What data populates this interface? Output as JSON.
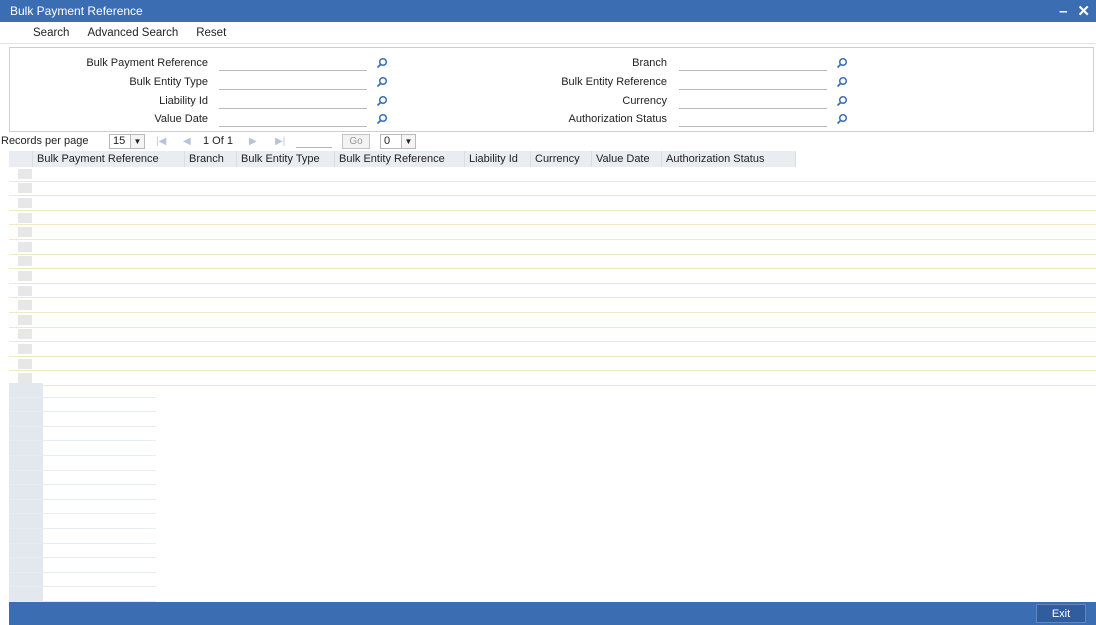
{
  "window": {
    "title": "Bulk Payment Reference",
    "minimize": "–",
    "close": "✕"
  },
  "toolbar": {
    "search": "Search",
    "advanced_search": "Advanced Search",
    "reset": "Reset"
  },
  "criteria": {
    "left": [
      {
        "label": "Bulk Payment Reference",
        "value": ""
      },
      {
        "label": "Bulk Entity Type",
        "value": ""
      },
      {
        "label": "Liability Id",
        "value": ""
      },
      {
        "label": "Value Date",
        "value": ""
      }
    ],
    "right": [
      {
        "label": "Branch",
        "value": ""
      },
      {
        "label": "Bulk Entity Reference",
        "value": ""
      },
      {
        "label": "Currency",
        "value": ""
      },
      {
        "label": "Authorization Status",
        "value": ""
      }
    ]
  },
  "pager": {
    "records_label": "Records per page",
    "records_value": "15",
    "page_info": "1 Of 1",
    "go_label": "Go",
    "go_select_value": "0"
  },
  "grid": {
    "columns": [
      "Bulk Payment Reference",
      "Branch",
      "Bulk Entity Type",
      "Bulk Entity Reference",
      "Liability Id",
      "Currency",
      "Value Date",
      "Authorization Status"
    ],
    "empty_rows": 15
  },
  "footer": {
    "exit_label": "Exit"
  },
  "colors": {
    "title_bar": "#3b6db3",
    "header_bg": "#e9ecf1"
  }
}
